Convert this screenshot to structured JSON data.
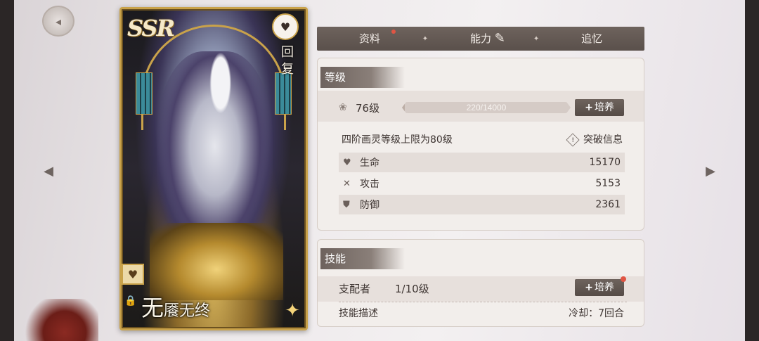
{
  "card": {
    "rarity": "SSR",
    "heal_label": "回复",
    "name_first": "无",
    "name_rest": "餍无终"
  },
  "tabs": [
    {
      "label": "资料",
      "active": false,
      "dot": true
    },
    {
      "label": "能力",
      "active": true,
      "dot": true
    },
    {
      "label": "追忆",
      "active": false,
      "dot": false
    }
  ],
  "level": {
    "section_title": "等级",
    "level_text": "76级",
    "exp_text": "220/14000",
    "exp_current": 220,
    "exp_max": 14000,
    "train_label": "培养",
    "cap_text": "四阶画灵等级上限为80级",
    "break_label": "突破信息"
  },
  "stats": [
    {
      "icon": "heart-icon",
      "label": "生命",
      "value": "15170"
    },
    {
      "icon": "swords-icon",
      "label": "攻击",
      "value": "5153"
    },
    {
      "icon": "shield-icon",
      "label": "防御",
      "value": "2361"
    }
  ],
  "skill": {
    "section_title": "技能",
    "name": "支配者",
    "level": "1/10级",
    "train_label": "培养",
    "desc_label": "技能描述",
    "cooldown": "冷却：7回合"
  },
  "colors": {
    "accent_dark": "#5a504b",
    "gold": "#c9a24a",
    "red_dot": "#e05544",
    "panel_bg": "#f2eeeb"
  }
}
